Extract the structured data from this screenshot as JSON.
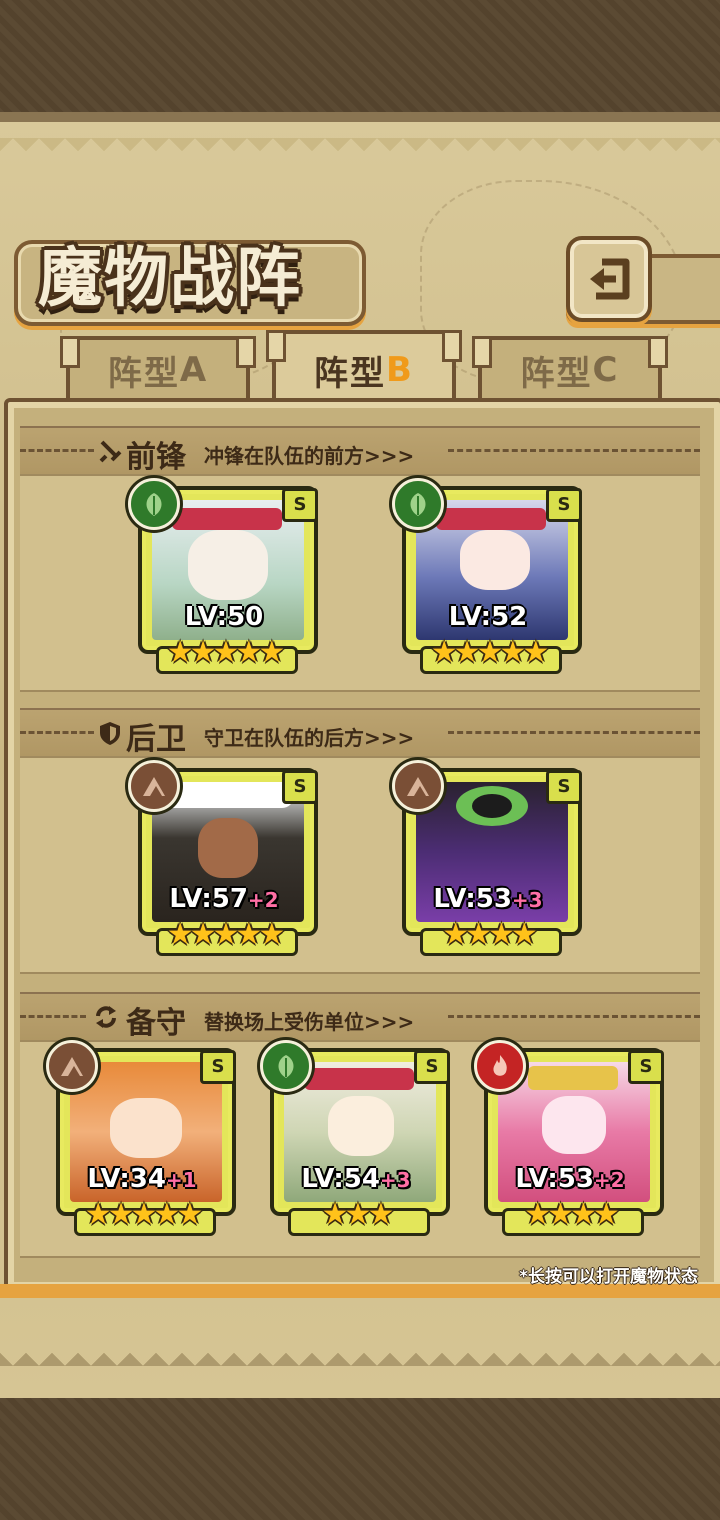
{
  "header": {
    "title": "魔物战阵"
  },
  "tabs": [
    {
      "label": "阵型",
      "letter": "A"
    },
    {
      "label": "阵型",
      "letter": "B"
    },
    {
      "label": "阵型",
      "letter": "C"
    }
  ],
  "active_tab": "B",
  "sections": {
    "vanguard": {
      "title": "前锋",
      "desc": "冲锋在队伍的前方>>>",
      "icon": "sword-icon"
    },
    "rearguard": {
      "title": "后卫",
      "desc": "守卫在队伍的后方>>>",
      "icon": "shield-icon"
    },
    "reserve": {
      "title": "备守",
      "desc": "替换场上受伤单位>>>",
      "icon": "swap-icon"
    }
  },
  "cards": {
    "v1": {
      "level": "LV:50",
      "bonus": "",
      "stars": "★★★★★",
      "rank": "S",
      "element": "leaf-icon",
      "star_count": 5
    },
    "v2": {
      "level": "LV:52",
      "bonus": "",
      "stars": "★★★★★",
      "rank": "S",
      "element": "leaf-icon",
      "star_count": 5
    },
    "r1": {
      "level": "LV:57",
      "bonus": "+2",
      "stars": "★★★★★",
      "rank": "S",
      "element": "earth-icon",
      "star_count": 5
    },
    "r2": {
      "level": "LV:53",
      "bonus": "+3",
      "stars": "★★★★",
      "rank": "S",
      "element": "earth-icon",
      "star_count": 4
    },
    "b1": {
      "level": "LV:34",
      "bonus": "+1",
      "stars": "★★★★★",
      "rank": "S",
      "element": "earth-icon",
      "star_count": 5
    },
    "b2": {
      "level": "LV:54",
      "bonus": "+3",
      "stars": "★★★",
      "rank": "S",
      "element": "leaf-icon",
      "star_count": 3
    },
    "b3": {
      "level": "LV:53",
      "bonus": "+2",
      "stars": "★★★★",
      "rank": "S",
      "element": "fire-icon",
      "star_count": 4
    }
  },
  "colors": {
    "leaf": "#2f7a2a",
    "earth": "#7a4f36",
    "fire": "#c42424",
    "accent": "#e6a340"
  },
  "hint": "*长按可以打开魔物状态"
}
